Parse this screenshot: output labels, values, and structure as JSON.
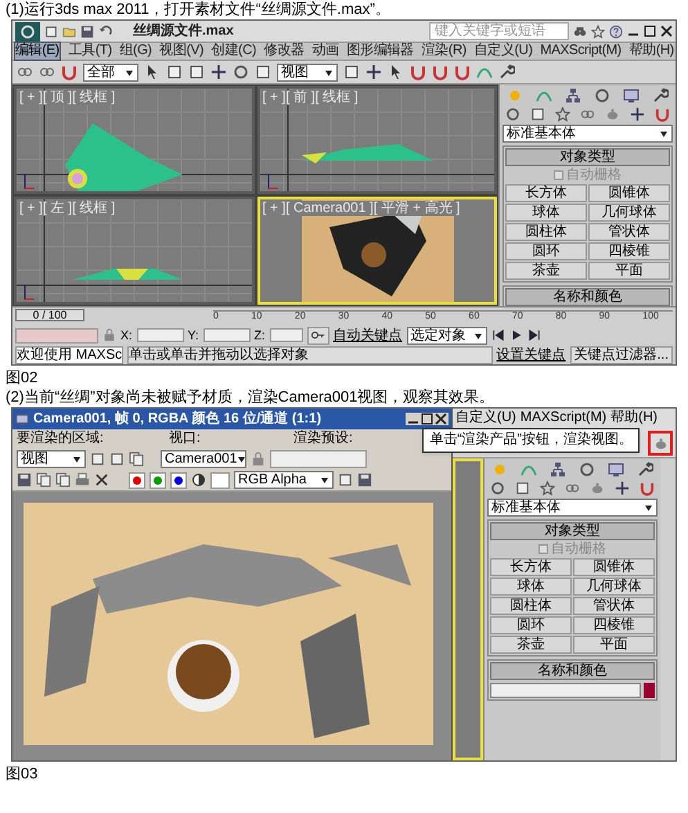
{
  "step1": {
    "caption": "(1)运行3ds max 2011，打开素材文件“丝绸源文件.max”。"
  },
  "figure1": {
    "title": "丝绸源文件.max",
    "search_placeholder": "键入关键字或短语",
    "menu": [
      {
        "label": "编辑(E)",
        "selected": true
      },
      {
        "label": "工具(T)",
        "selected": false
      },
      {
        "label": "组(G)",
        "selected": false
      },
      {
        "label": "视图(V)",
        "selected": false
      },
      {
        "label": "创建(C)",
        "selected": false
      },
      {
        "label": "修改器",
        "selected": false
      },
      {
        "label": "动画",
        "selected": false
      },
      {
        "label": "图形编辑器",
        "selected": false
      },
      {
        "label": "渲染(R)",
        "selected": false
      },
      {
        "label": "自定义(U)",
        "selected": false
      },
      {
        "label": "MAXScript(M)",
        "selected": false
      },
      {
        "label": "帮助(H)",
        "selected": false
      }
    ],
    "toolbar": {
      "selection_filter": "全部",
      "coordinate_system": "视图"
    },
    "viewports": [
      {
        "label": "[ + ][ 顶 ][ 线框 ]",
        "kind": "top",
        "active": false
      },
      {
        "label": "[ + ][ 前 ][ 线框 ]",
        "kind": "front",
        "active": false
      },
      {
        "label": "[ + ][ 左 ][ 线框 ]",
        "kind": "left",
        "active": false
      },
      {
        "label": "[ + ][ Camera001 ][ 平滑 + 高光 ]",
        "kind": "camera",
        "active": true
      }
    ],
    "command_panel": {
      "category": "标准基本体",
      "rollout": "对象类型",
      "autogrid": {
        "label": "自动栅格",
        "checked": false
      },
      "buttons": [
        "长方体",
        "圆锥体",
        "球体",
        "几何球体",
        "圆柱体",
        "管状体",
        "圆环",
        "四棱锥",
        "茶壶",
        "平面"
      ],
      "name_rollout": "名称和颜色"
    },
    "time_slider": {
      "label": "0 / 100"
    },
    "ticks": [
      "0",
      "10",
      "20",
      "30",
      "40",
      "50",
      "60",
      "70",
      "80",
      "90",
      "100"
    ],
    "status": {
      "welcome": "欢迎使用 MAXSc",
      "prompt": "单击或单击并拖动以选择对象",
      "x_label": "X:",
      "y_label": "Y:",
      "z_label": "Z:",
      "auto_key": "自动关键点",
      "key_mode": "选定对象",
      "set_key": "设置关键点",
      "key_filters": "关键点过滤器..."
    }
  },
  "figure1_label": "图02",
  "step2": {
    "caption": "(2)当前“丝绸”对象尚未被赋予材质，渲染Camera001视图，观察其效果。"
  },
  "figure2": {
    "render_window": {
      "title": "Camera001, 帧 0, RGBA 颜色 16 位/通道 (1:1)",
      "area_label": "要渲染的区域:",
      "area": "视图",
      "viewport_label": "视口:",
      "viewport": "Camera001",
      "preset_label": "渲染预设:",
      "channels": [
        {
          "color": "#e00000"
        },
        {
          "color": "#00a000"
        },
        {
          "color": "#0000e0"
        }
      ],
      "channel_display": "RGB Alpha"
    },
    "menu": [
      "自定义(U)",
      "MAXScript(M)",
      "帮助(H)"
    ],
    "callout": "单击“渲染产品”按钮，渲染视图。",
    "command_panel": {
      "category": "标准基本体",
      "rollout": "对象类型",
      "autogrid": {
        "label": "自动栅格",
        "checked": false
      },
      "buttons": [
        "长方体",
        "圆锥体",
        "球体",
        "几何球体",
        "圆柱体",
        "管状体",
        "圆环",
        "四棱锥",
        "茶壶",
        "平面"
      ],
      "name_rollout": "名称和颜色"
    }
  },
  "figure2_label": "图03"
}
